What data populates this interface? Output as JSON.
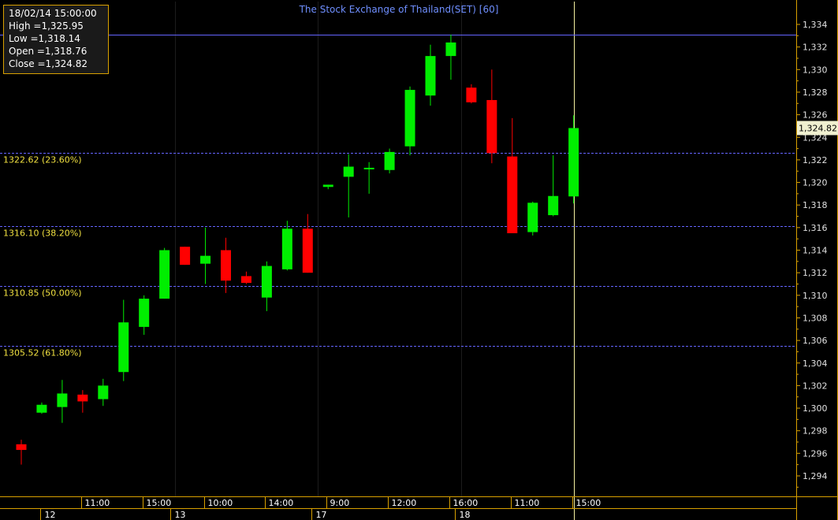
{
  "chart_data": {
    "type": "candlestick",
    "title": "The Stock Exchange of Thailand(SET) [60]",
    "ylim": [
      1292,
      1335.5
    ],
    "yticks": [
      "1,294",
      "1,296",
      "1,298",
      "1,300",
      "1,302",
      "1,304",
      "1,306",
      "1,308",
      "1,310",
      "1,312",
      "1,314",
      "1,316",
      "1,318",
      "1,320",
      "1,322",
      "1,324",
      "1,326",
      "1,328",
      "1,330",
      "1,332",
      "1,334"
    ],
    "ytick_values": [
      1294,
      1296,
      1298,
      1300,
      1302,
      1304,
      1306,
      1308,
      1310,
      1312,
      1314,
      1316,
      1318,
      1320,
      1322,
      1324,
      1326,
      1328,
      1330,
      1332,
      1334
    ],
    "candles": [
      {
        "open": 1296.8,
        "high": 1297.2,
        "low": 1295.0,
        "close": 1296.3
      },
      {
        "open": 1299.6,
        "high": 1300.5,
        "low": 1299.5,
        "close": 1300.3
      },
      {
        "open": 1300.1,
        "high": 1302.5,
        "low": 1298.7,
        "close": 1301.3
      },
      {
        "open": 1301.2,
        "high": 1301.6,
        "low": 1299.6,
        "close": 1300.6
      },
      {
        "open": 1300.8,
        "high": 1302.6,
        "low": 1300.2,
        "close": 1302.0
      },
      {
        "open": 1303.2,
        "high": 1309.6,
        "low": 1302.4,
        "close": 1307.6
      },
      {
        "open": 1307.2,
        "high": 1310.0,
        "low": 1306.5,
        "close": 1309.7
      },
      {
        "open": 1309.7,
        "high": 1314.2,
        "low": 1309.7,
        "close": 1314.0
      },
      {
        "open": 1314.3,
        "high": 1314.3,
        "low": 1312.7,
        "close": 1312.7
      },
      {
        "open": 1312.8,
        "high": 1316.0,
        "low": 1311.0,
        "close": 1313.5
      },
      {
        "open": 1314.0,
        "high": 1315.1,
        "low": 1310.2,
        "close": 1311.3
      },
      {
        "open": 1311.7,
        "high": 1312.1,
        "low": 1311.0,
        "close": 1311.1
      },
      {
        "open": 1309.8,
        "high": 1313.0,
        "low": 1308.6,
        "close": 1312.6
      },
      {
        "open": 1312.3,
        "high": 1316.6,
        "low": 1312.2,
        "close": 1315.9
      },
      {
        "open": 1315.9,
        "high": 1317.2,
        "low": 1312.0,
        "close": 1312.0
      },
      {
        "open": 1319.6,
        "high": 1319.8,
        "low": 1319.4,
        "close": 1319.8
      },
      {
        "open": 1320.5,
        "high": 1322.5,
        "low": 1316.9,
        "close": 1321.4
      },
      {
        "open": 1321.2,
        "high": 1321.8,
        "low": 1319.0,
        "close": 1321.3
      },
      {
        "open": 1321.1,
        "high": 1323.0,
        "low": 1320.8,
        "close": 1322.7
      },
      {
        "open": 1323.2,
        "high": 1328.5,
        "low": 1322.4,
        "close": 1328.2
      },
      {
        "open": 1327.7,
        "high": 1332.2,
        "low": 1326.8,
        "close": 1331.2
      },
      {
        "open": 1331.2,
        "high": 1333.1,
        "low": 1329.1,
        "close": 1332.4
      },
      {
        "open": 1328.4,
        "high": 1328.7,
        "low": 1327.0,
        "close": 1327.1
      },
      {
        "open": 1327.3,
        "high": 1330.0,
        "low": 1321.7,
        "close": 1322.6
      },
      {
        "open": 1322.3,
        "high": 1325.7,
        "low": 1315.5,
        "close": 1315.5
      },
      {
        "open": 1315.6,
        "high": 1318.3,
        "low": 1315.3,
        "close": 1318.2
      },
      {
        "open": 1317.1,
        "high": 1322.4,
        "low": 1317.0,
        "close": 1318.8
      },
      {
        "open": 1318.76,
        "high": 1325.95,
        "low": 1318.14,
        "close": 1324.82
      }
    ],
    "fib_levels": [
      {
        "value": 1322.62,
        "label": "1322.62 (23.60%)"
      },
      {
        "value": 1316.1,
        "label": "1316.10 (38.20%)"
      },
      {
        "value": 1310.85,
        "label": "1310.85 (50.00%)"
      },
      {
        "value": 1305.52,
        "label": "1305.52 (61.80%)"
      }
    ],
    "top_line": 1333.1,
    "current_value": 1324.82,
    "current_label": "1,324.82",
    "time_labels": [
      {
        "index": 3,
        "label": "11:00"
      },
      {
        "index": 6,
        "label": "15:00"
      },
      {
        "index": 9,
        "label": "10:00"
      },
      {
        "index": 12,
        "label": "14:00"
      },
      {
        "index": 15,
        "label": "9:00"
      },
      {
        "index": 18,
        "label": "12:00"
      },
      {
        "index": 21,
        "label": "16:00"
      },
      {
        "index": 24,
        "label": "11:00"
      },
      {
        "index": 27,
        "label": "15:00"
      }
    ],
    "day_labels": [
      {
        "index": 1,
        "label": "12"
      },
      {
        "index": 8,
        "label": "13"
      },
      {
        "index": 15,
        "label": "17"
      },
      {
        "index": 22,
        "label": "18"
      }
    ],
    "up_color": "#00ee00",
    "down_color": "#ff0000",
    "fib_color": "#6464ff",
    "axis_color": "#d8a000",
    "crosshair_color": "#f5f0a0"
  },
  "info": {
    "date": "18/02/14 15:00:00",
    "high": "High  =1,325.95",
    "low": "Low  =1,318.14",
    "open": "Open  =1,318.76",
    "close": "Close  =1,324.82"
  }
}
